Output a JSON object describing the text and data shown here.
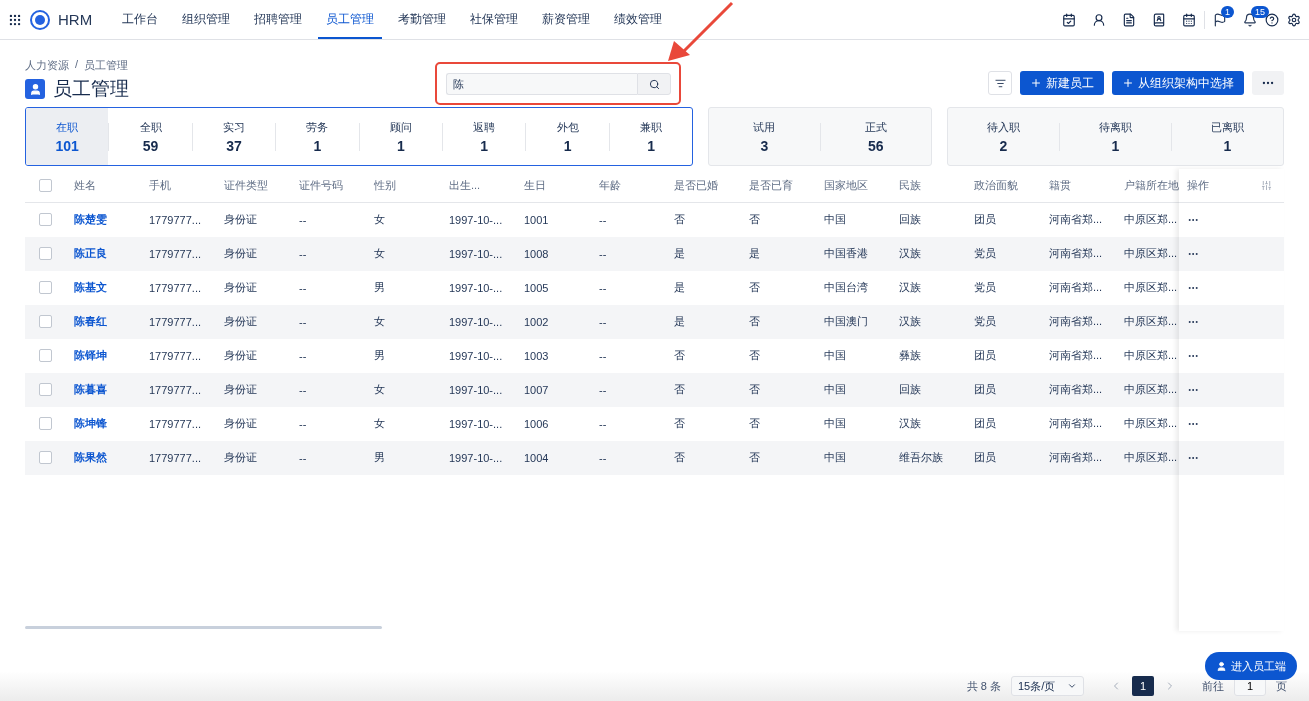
{
  "nav": {
    "brand": "HRM",
    "items": [
      {
        "label": "工作台",
        "selected": false
      },
      {
        "label": "组织管理",
        "selected": false
      },
      {
        "label": "招聘管理",
        "selected": false
      },
      {
        "label": "员工管理",
        "selected": true
      },
      {
        "label": "考勤管理",
        "selected": false
      },
      {
        "label": "社保管理",
        "selected": false
      },
      {
        "label": "薪资管理",
        "selected": false
      },
      {
        "label": "绩效管理",
        "selected": false
      }
    ],
    "flag_badge": "1",
    "bell_badge": "15"
  },
  "breadcrumb": [
    "人力资源",
    "员工管理"
  ],
  "breadcrumb_separator": "/",
  "page_title": "员工管理",
  "search": {
    "value": "陈"
  },
  "buttons": [
    "新建员工",
    "从组织架构中选择"
  ],
  "stat_groups": [
    {
      "items": [
        {
          "label": "在职",
          "count": "101",
          "selected": true
        },
        {
          "label": "全职",
          "count": "59",
          "selected": false
        },
        {
          "label": "实习",
          "count": "37",
          "selected": false
        },
        {
          "label": "劳务",
          "count": "1",
          "selected": false
        },
        {
          "label": "顾问",
          "count": "1",
          "selected": false
        },
        {
          "label": "返聘",
          "count": "1",
          "selected": false
        },
        {
          "label": "外包",
          "count": "1",
          "selected": false
        },
        {
          "label": "兼职",
          "count": "1",
          "selected": false
        }
      ]
    },
    {
      "items": [
        {
          "label": "试用",
          "count": "3",
          "selected": false
        },
        {
          "label": "正式",
          "count": "56",
          "selected": false
        }
      ]
    },
    {
      "items": [
        {
          "label": "待入职",
          "count": "2",
          "selected": false
        },
        {
          "label": "待离职",
          "count": "1",
          "selected": false
        },
        {
          "label": "已离职",
          "count": "1",
          "selected": false
        }
      ]
    }
  ],
  "table": {
    "columns": [
      "姓名",
      "手机",
      "证件类型",
      "证件号码",
      "性别",
      "出生...",
      "生日",
      "年龄",
      "是否已婚",
      "是否已育",
      "国家地区",
      "民族",
      "政治面貌",
      "籍贯",
      "户籍所在地"
    ],
    "action_column": "操作",
    "header_checked": false,
    "rows": [
      {
        "checked": false,
        "cells": [
          "陈楚雯",
          "1779777...",
          "身份证",
          "--",
          "女",
          "1997-10-...",
          "1001",
          "--",
          "否",
          "否",
          "中国",
          "回族",
          "团员",
          "河南省郑...",
          "中原区郑..."
        ]
      },
      {
        "checked": false,
        "cells": [
          "陈正良",
          "1779777...",
          "身份证",
          "--",
          "女",
          "1997-10-...",
          "1008",
          "--",
          "是",
          "是",
          "中国香港",
          "汉族",
          "党员",
          "河南省郑...",
          "中原区郑..."
        ]
      },
      {
        "checked": false,
        "cells": [
          "陈基文",
          "1779777...",
          "身份证",
          "--",
          "男",
          "1997-10-...",
          "1005",
          "--",
          "是",
          "否",
          "中国台湾",
          "汉族",
          "党员",
          "河南省郑...",
          "中原区郑..."
        ]
      },
      {
        "checked": false,
        "cells": [
          "陈春红",
          "1779777...",
          "身份证",
          "--",
          "女",
          "1997-10-...",
          "1002",
          "--",
          "是",
          "否",
          "中国澳门",
          "汉族",
          "党员",
          "河南省郑...",
          "中原区郑..."
        ]
      },
      {
        "checked": false,
        "cells": [
          "陈铎坤",
          "1779777...",
          "身份证",
          "--",
          "男",
          "1997-10-...",
          "1003",
          "--",
          "否",
          "否",
          "中国",
          "彝族",
          "团员",
          "河南省郑...",
          "中原区郑..."
        ]
      },
      {
        "checked": false,
        "cells": [
          "陈暮喜",
          "1779777...",
          "身份证",
          "--",
          "女",
          "1997-10-...",
          "1007",
          "--",
          "否",
          "否",
          "中国",
          "回族",
          "团员",
          "河南省郑...",
          "中原区郑..."
        ]
      },
      {
        "checked": false,
        "cells": [
          "陈坤锋",
          "1779777...",
          "身份证",
          "--",
          "女",
          "1997-10-...",
          "1006",
          "--",
          "否",
          "否",
          "中国",
          "汉族",
          "团员",
          "河南省郑...",
          "中原区郑..."
        ]
      },
      {
        "checked": false,
        "cells": [
          "陈果然",
          "1779777...",
          "身份证",
          "--",
          "男",
          "1997-10-...",
          "1004",
          "--",
          "否",
          "否",
          "中国",
          "维吾尔族",
          "团员",
          "河南省郑...",
          "中原区郑..."
        ]
      }
    ]
  },
  "pagination": {
    "total": "共 8 条",
    "page_size": "15条/页",
    "pages": [
      {
        "label": "1",
        "selected": true
      }
    ],
    "goto_label": "前往",
    "goto_value": "1",
    "goto_suffix": "页"
  },
  "float_button": "进入员工端"
}
